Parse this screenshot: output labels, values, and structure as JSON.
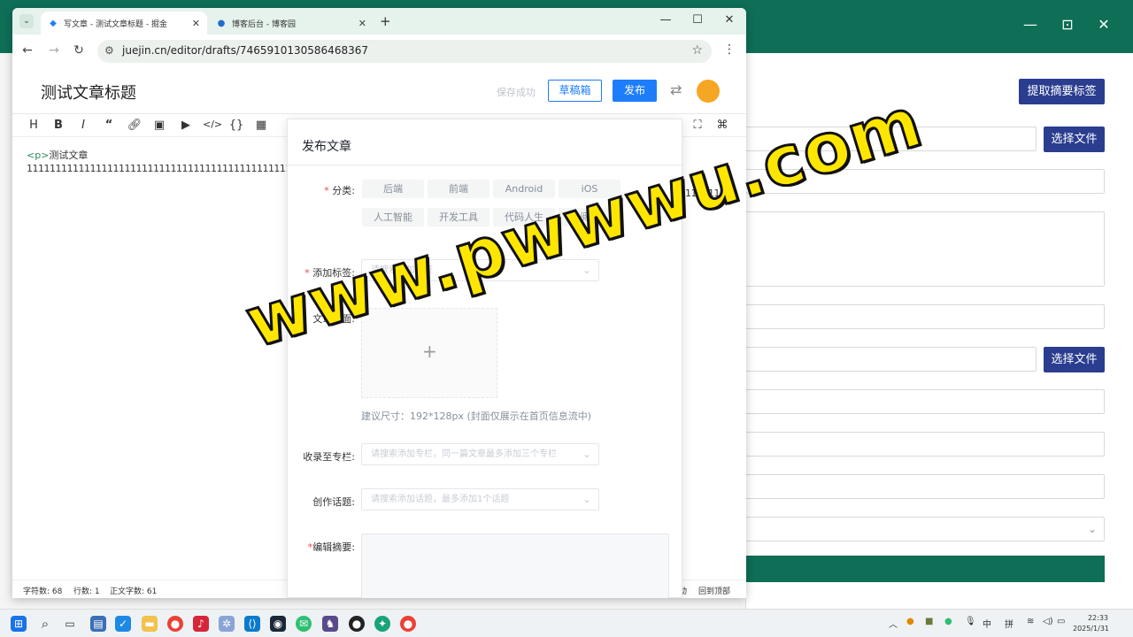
{
  "browser": {
    "tabs": [
      {
        "title": "写文章 - 测试文章标题 - 掘金",
        "active": true
      },
      {
        "title": "博客后台 - 博客园",
        "active": false
      }
    ],
    "url": "juejin.cn/editor/drafts/7465910130586468367"
  },
  "editor": {
    "title": "测试文章标题",
    "save_status": "保存成功",
    "draft_label": "草稿箱",
    "publish_label": "发布",
    "toolbar": [
      "H",
      "B",
      "I",
      "“",
      "link",
      "image",
      "video",
      "code",
      "{}",
      "table"
    ],
    "content_tag": "<p>",
    "content_line1": "测试文章",
    "content_line2": "11111111111111111111111111111111111111111111111111",
    "content_right": "11111111",
    "status": {
      "chars": "字符数: 68",
      "lines": "行数: 1",
      "words": "正文字数: 61",
      "sync": "动",
      "top": "回到顶部"
    }
  },
  "panel": {
    "title": "发布文章",
    "category_label": "分类:",
    "categories": [
      "后端",
      "前端",
      "Android",
      "iOS",
      "人工智能",
      "开发工具",
      "代码人生",
      "阅读"
    ],
    "tag_label": "添加标签:",
    "tag_placeholder": "请搜索添加标签",
    "cover_label": "文章封面:",
    "cover_hint": "建议尺寸：192*128px (封面仅展示在首页信息流中)",
    "column_label": "收录至专栏:",
    "column_placeholder": "请搜索添加专栏，同一篇文章最多添加三个专栏",
    "topic_label": "创作话题:",
    "topic_placeholder": "请搜索添加话题，最多添加1个话题",
    "summary_label": "编辑摘要:"
  },
  "background_app": {
    "extract_btn": "提取摘要标签",
    "choose_file_1": "选择文件",
    "choose_file_2": "选择文件"
  },
  "watermark": "www.pwwwu.com",
  "taskbar": {
    "tray_lang1": "中",
    "tray_lang2": "拼",
    "time": "22:33",
    "date": "2025/1/31"
  },
  "colors": {
    "accent": "#1d7dfa",
    "bg_app_title": "#0e6e56",
    "bg_app_button": "#2a3d8f"
  }
}
